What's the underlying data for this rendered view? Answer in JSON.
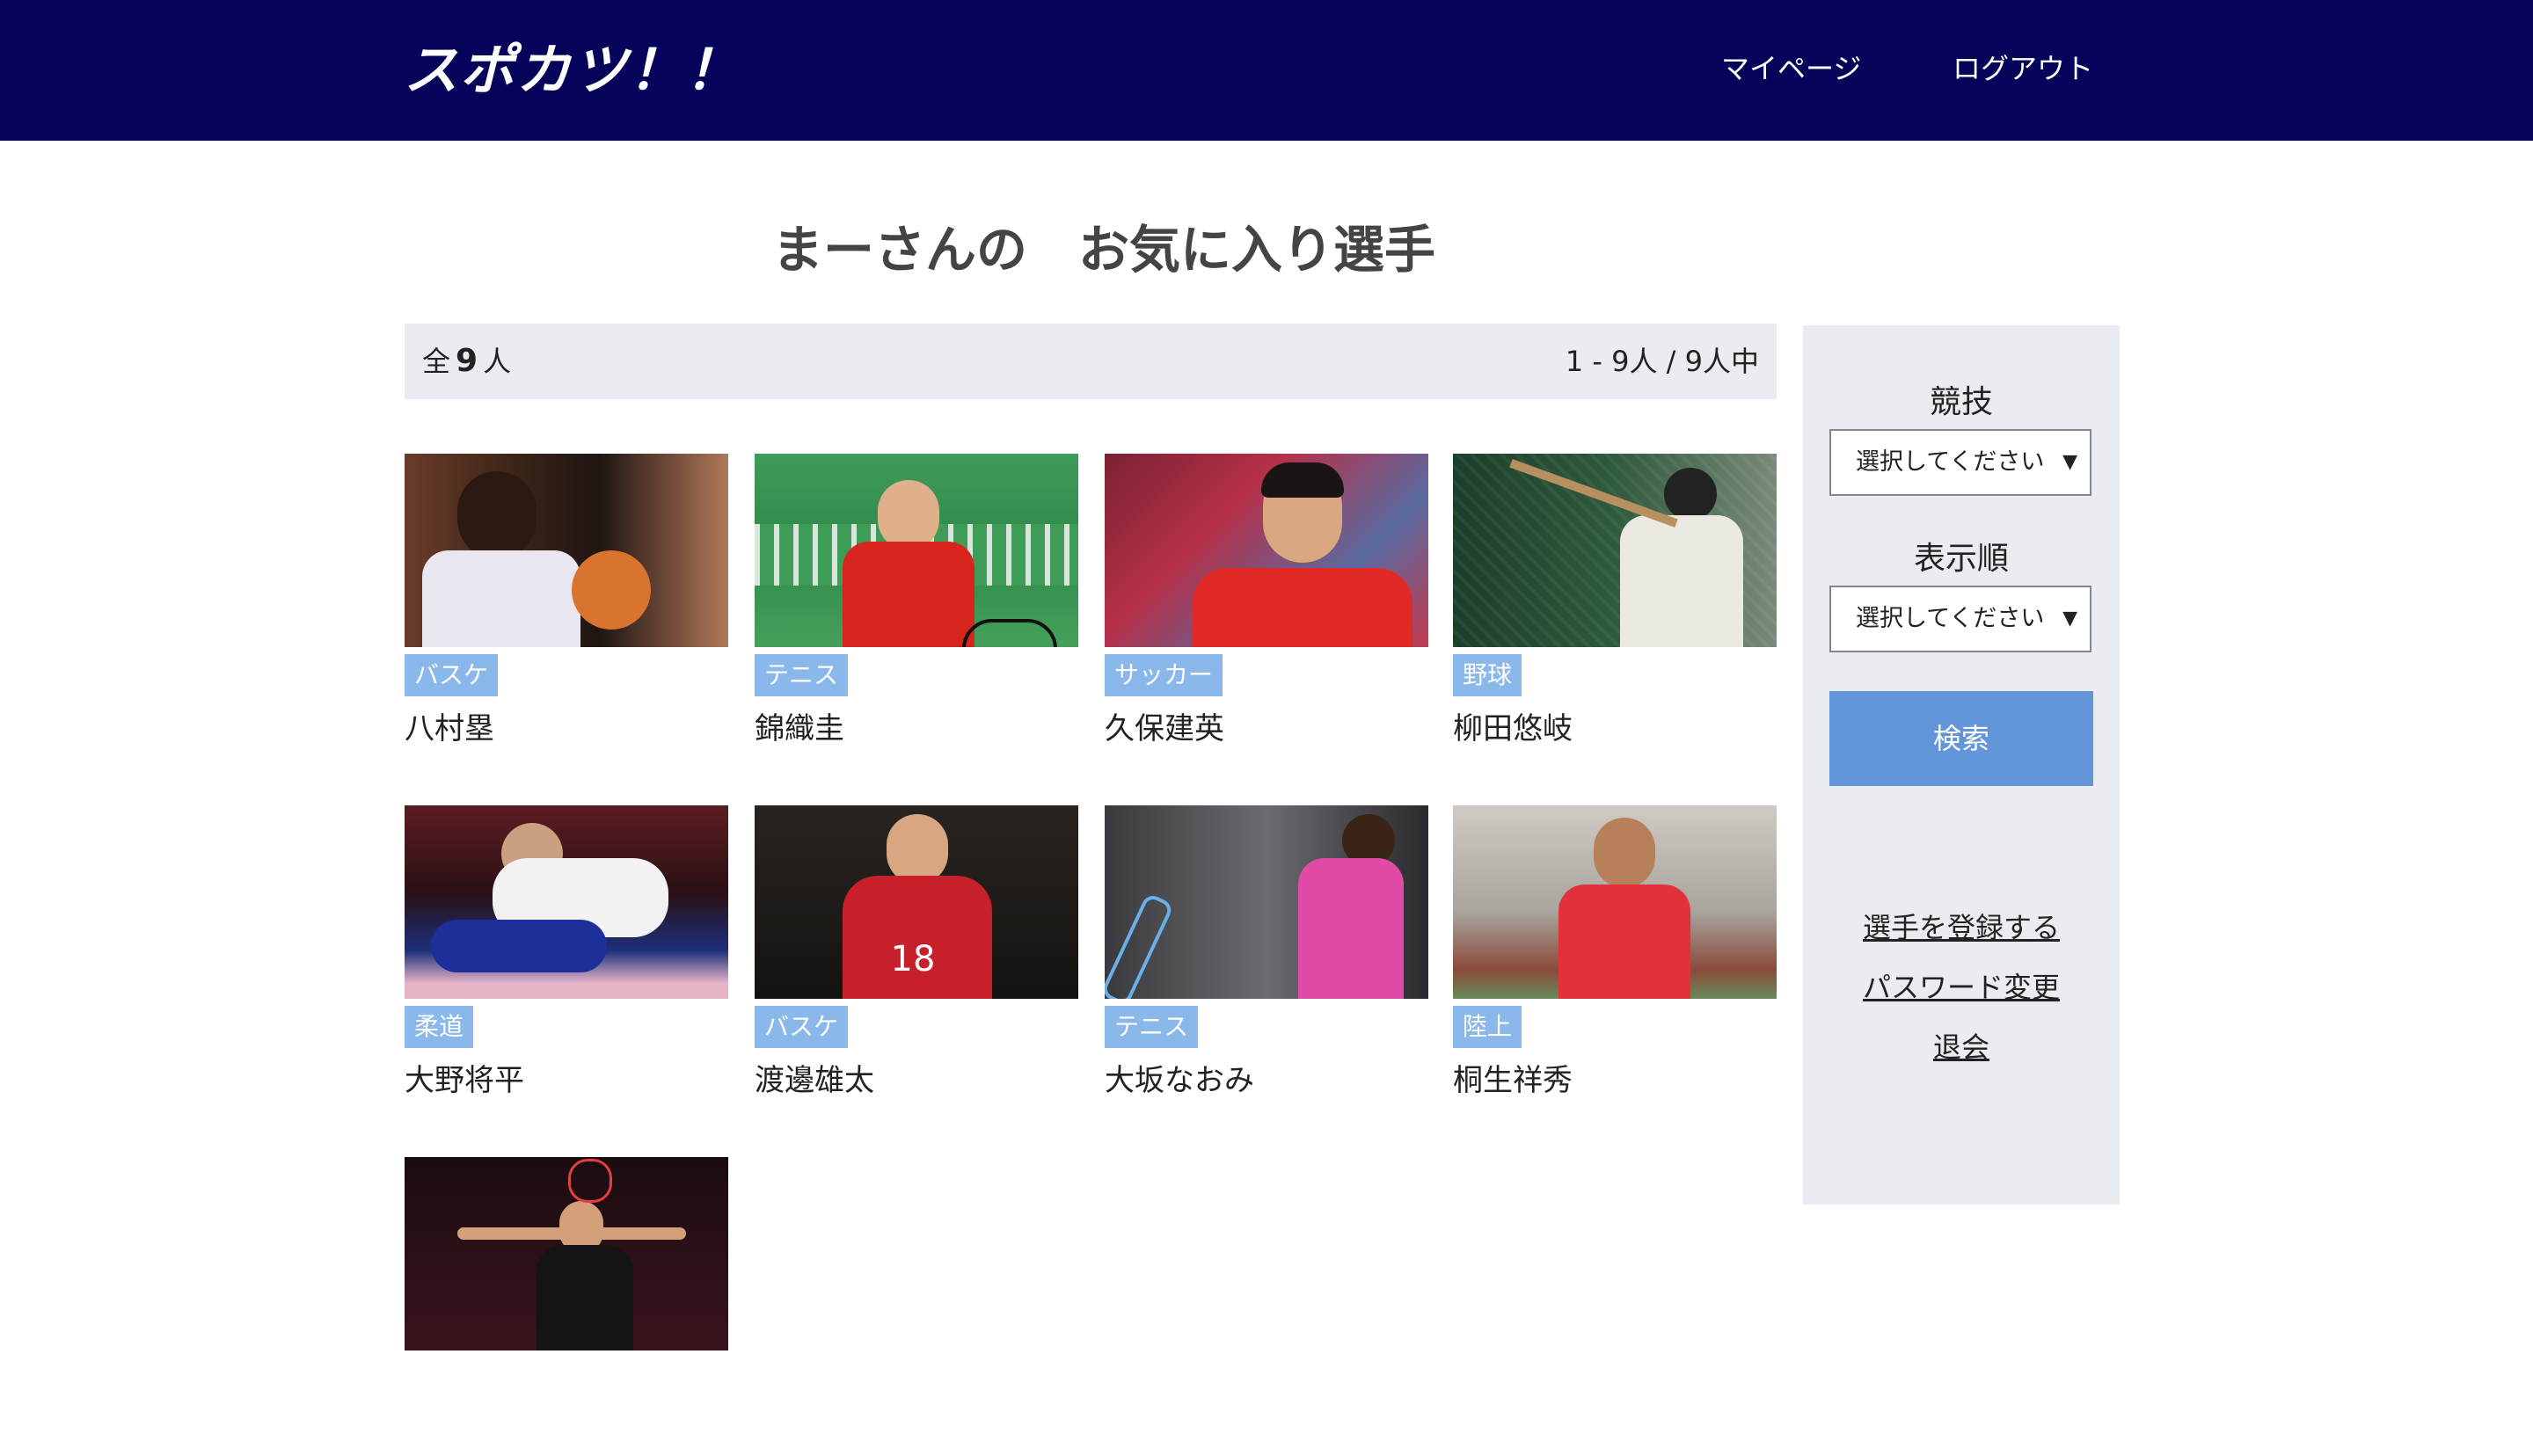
{
  "header": {
    "logo": "スポカツ！！",
    "nav": [
      "マイページ",
      "ログアウト"
    ]
  },
  "page": {
    "title": "まーさんの　お気に入り選手"
  },
  "count": {
    "prefix": "全",
    "total": "9",
    "suffix": "人",
    "range": "1 - 9人 / 9人中"
  },
  "players": [
    {
      "sport": "バスケ",
      "name": "八村塁"
    },
    {
      "sport": "テニス",
      "name": "錦織圭"
    },
    {
      "sport": "サッカー",
      "name": "久保建英"
    },
    {
      "sport": "野球",
      "name": "柳田悠岐"
    },
    {
      "sport": "柔道",
      "name": "大野将平"
    },
    {
      "sport": "バスケ",
      "name": "渡邊雄太"
    },
    {
      "sport": "テニス",
      "name": "大坂なおみ"
    },
    {
      "sport": "陸上",
      "name": "桐生祥秀"
    },
    {
      "sport": "",
      "name": ""
    }
  ],
  "sidebar": {
    "sport_label": "競技",
    "sport_select": "選択してください",
    "order_label": "表示順",
    "order_select": "選択してください",
    "search_button": "検索",
    "links": [
      "選手を登録する",
      "パスワード変更",
      "退会"
    ]
  },
  "colors": {
    "header_bg": "#06045a",
    "tag_bg": "#8ab8ea",
    "button_bg": "#6296d8",
    "panel_bg": "#e9edf2"
  }
}
